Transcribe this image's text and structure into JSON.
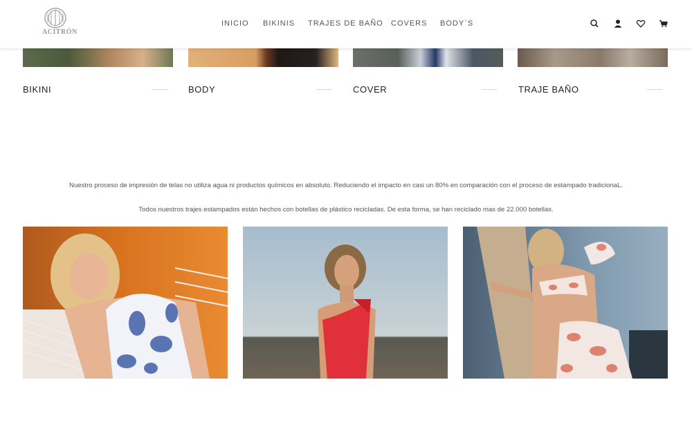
{
  "header": {
    "logo_text": "ACITRÓN",
    "nav": [
      "INICIO",
      "BIKINIS",
      "TRAJES DE BAÑO",
      "COVERS",
      "BODY`S"
    ],
    "icons": [
      "search-icon",
      "user-icon",
      "heart-icon",
      "cart-icon"
    ]
  },
  "categories": [
    "BIKINI",
    "BODY",
    "COVER",
    "TRAJE BAÑO"
  ],
  "info": {
    "line1": "Nuestro proceso de impresión de telas no utiliza agua ni productos químicos en absoluto. Reduciendo el impacto en casi un 80% en comparación con el proceso de estampado tradicionaL.",
    "line2": "Todos nuestros trajes estampados están hechos con botellas de plástico recicladas. De esta forma, se han reciclado mas de 22.000 botellas."
  },
  "colors": {
    "accent": "#e63946",
    "text": "#333333",
    "nav": "#555555"
  }
}
